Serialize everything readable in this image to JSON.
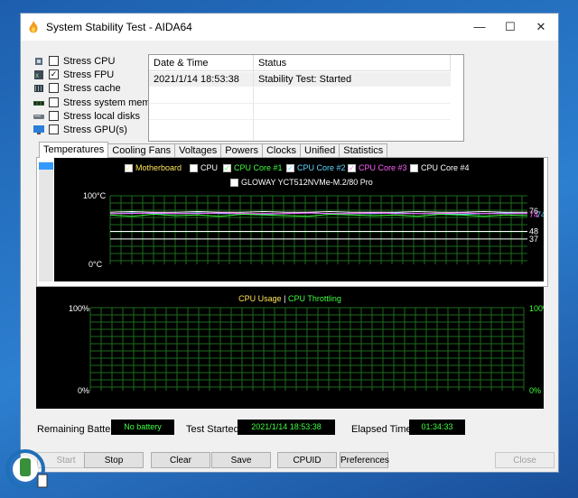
{
  "window": {
    "title": "System Stability Test - AIDA64"
  },
  "stress_options": [
    {
      "label": "Stress CPU",
      "checked": false,
      "icon": "cpu-icon"
    },
    {
      "label": "Stress FPU",
      "checked": true,
      "icon": "fpu-icon"
    },
    {
      "label": "Stress cache",
      "checked": false,
      "icon": "cache-icon"
    },
    {
      "label": "Stress system memory",
      "checked": false,
      "icon": "memory-icon"
    },
    {
      "label": "Stress local disks",
      "checked": false,
      "icon": "disk-icon"
    },
    {
      "label": "Stress GPU(s)",
      "checked": false,
      "icon": "gpu-icon"
    }
  ],
  "log": {
    "columns": [
      "Date & Time",
      "Status"
    ],
    "rows": [
      {
        "datetime": "2021/1/14 18:53:38",
        "status": "Stability Test: Started"
      }
    ]
  },
  "tabs": [
    "Temperatures",
    "Cooling Fans",
    "Voltages",
    "Powers",
    "Clocks",
    "Unified",
    "Statistics"
  ],
  "active_tab": "Temperatures",
  "temp_legend": [
    {
      "label": "Motherboard",
      "color": "#ffe45a"
    },
    {
      "label": "CPU",
      "color": "#ffffff"
    },
    {
      "label": "CPU Core #1",
      "color": "#3dff3d"
    },
    {
      "label": "CPU Core #2",
      "color": "#5fd8ff"
    },
    {
      "label": "CPU Core #3",
      "color": "#ff5fff"
    },
    {
      "label": "CPU Core #4",
      "color": "#ffffff"
    },
    {
      "label": "GLOWAY YCT512NVMe-M.2/80 Pro",
      "color": "#ffffff"
    }
  ],
  "chart_data": [
    {
      "type": "line",
      "title": "",
      "ylim": [
        0,
        100
      ],
      "y_tick_labels": [
        "100°C",
        "0°C"
      ],
      "grid": true,
      "series": [
        {
          "name": "CPU",
          "values": [
            76,
            77,
            76,
            76,
            77,
            76,
            76,
            77,
            76,
            76,
            77,
            76,
            76,
            76,
            77,
            76,
            76,
            77,
            76,
            76
          ],
          "color": "#ffffff"
        },
        {
          "name": "CPU Core #2",
          "values": [
            74,
            75,
            74,
            74,
            75,
            74,
            74,
            73,
            74,
            75,
            74,
            74,
            74,
            75,
            74,
            74,
            73,
            74,
            75,
            74
          ],
          "color": "#5fd8ff"
        },
        {
          "name": "CPU Core #3",
          "values": [
            74,
            74,
            75,
            74,
            74,
            75,
            74,
            74,
            74,
            75,
            74,
            74,
            75,
            74,
            74,
            74,
            75,
            74,
            74,
            74
          ],
          "color": "#ff5fff"
        },
        {
          "name": "CPU Core #1",
          "values": [
            72,
            70,
            73,
            71,
            72,
            70,
            73,
            72,
            71,
            70,
            73,
            72,
            71,
            72,
            70,
            73,
            72,
            70,
            72,
            71
          ],
          "color": "#3dff3d"
        },
        {
          "name": "Motherboard",
          "values": [
            48,
            48,
            48,
            48,
            48,
            48,
            48,
            48,
            48,
            48,
            48,
            48,
            48,
            48,
            48,
            48,
            48,
            48,
            48,
            48
          ],
          "color": "#ffffff"
        },
        {
          "name": "GLOWAY YCT512NVMe-M.2/80 Pro",
          "values": [
            37,
            37,
            37,
            37,
            37,
            37,
            37,
            37,
            37,
            37,
            37,
            37,
            37,
            37,
            37,
            37,
            37,
            37,
            37,
            37
          ],
          "color": "#ffffff"
        }
      ],
      "value_labels": [
        "76",
        "74",
        "74",
        "48",
        "37"
      ]
    },
    {
      "type": "line",
      "title": "CPU Usage | CPU Throttling",
      "series_labels": [
        {
          "text": "CPU Usage",
          "color": "#ffe45a"
        },
        {
          "text": "CPU Throttling",
          "color": "#3dff3d"
        }
      ],
      "ylim": [
        0,
        100
      ],
      "y_tick_labels": [
        "100%",
        "0%"
      ],
      "grid": true,
      "series": []
    }
  ],
  "status": {
    "battery_label": "Remaining Battery:",
    "battery_value": "No battery",
    "started_label": "Test Started:",
    "started_value": "2021/1/14 18:53:38",
    "elapsed_label": "Elapsed Time:",
    "elapsed_value": "01:34:33"
  },
  "buttons": [
    {
      "label": "Start",
      "enabled": false
    },
    {
      "label": "Stop",
      "enabled": true
    },
    {
      "label": "Clear",
      "enabled": true
    },
    {
      "label": "Save",
      "enabled": true
    },
    {
      "label": "CPUID",
      "enabled": true
    },
    {
      "label": "Preferences",
      "enabled": true
    },
    {
      "label": "Close",
      "enabled": false
    }
  ]
}
